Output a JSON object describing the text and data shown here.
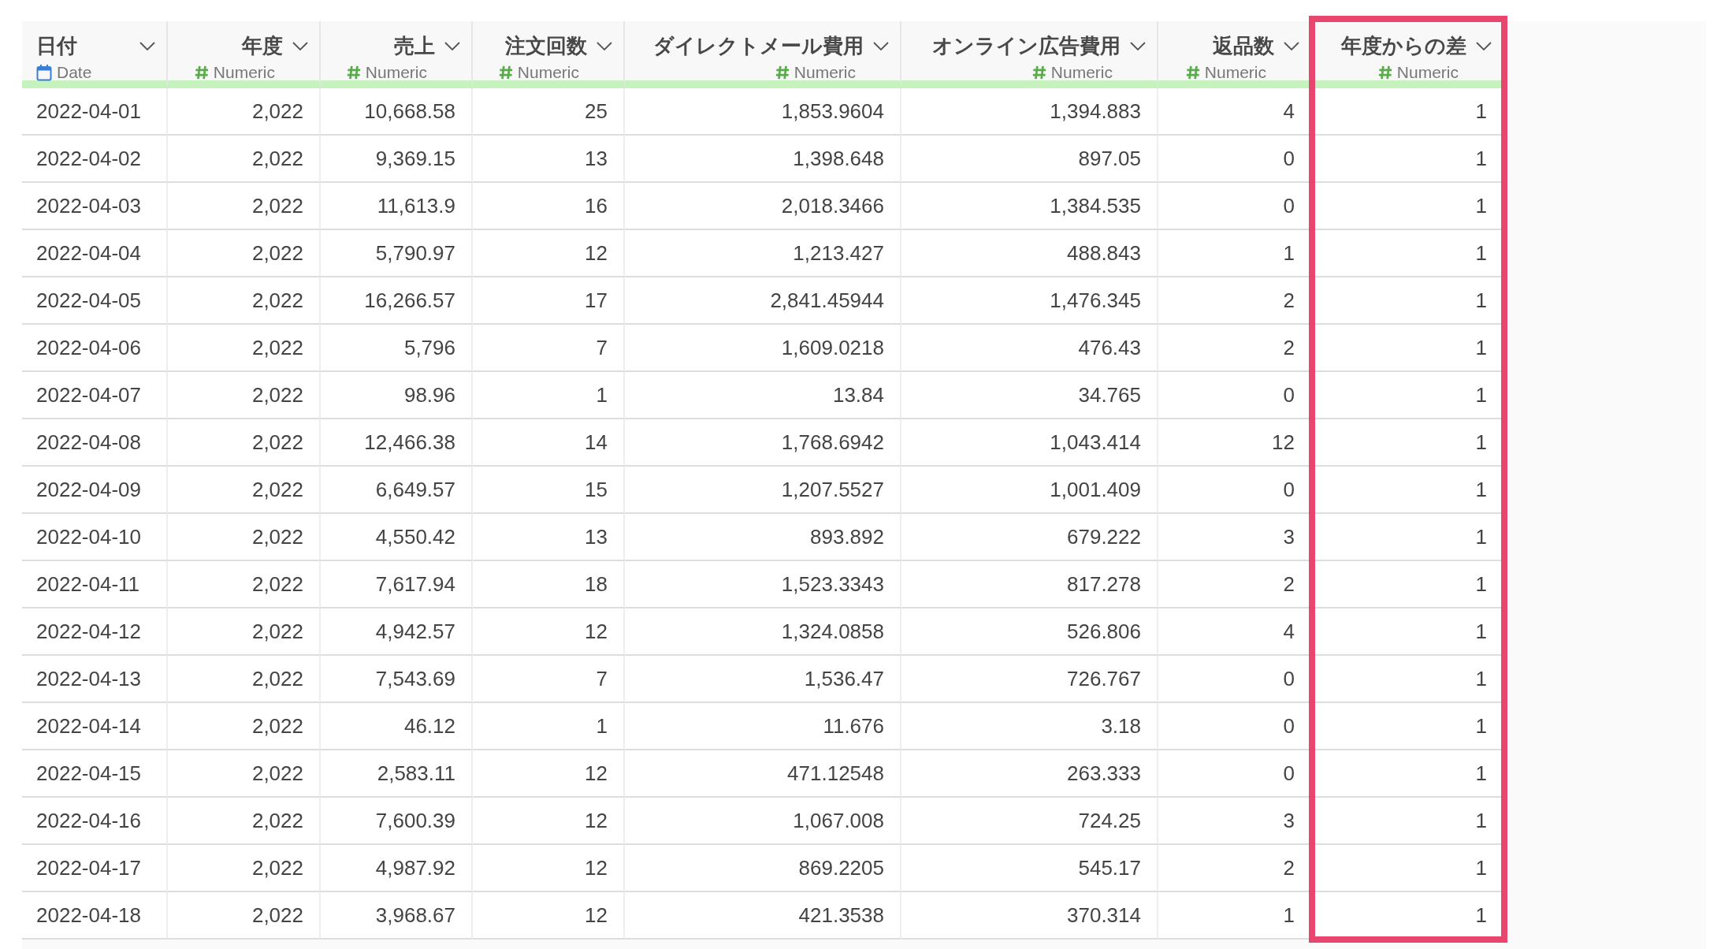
{
  "table": {
    "columns": [
      {
        "name": "日付",
        "type": "Date",
        "kind": "date",
        "highlighted": false
      },
      {
        "name": "年度",
        "type": "Numeric",
        "kind": "numeric",
        "highlighted": false
      },
      {
        "name": "売上",
        "type": "Numeric",
        "kind": "numeric",
        "highlighted": false
      },
      {
        "name": "注文回数",
        "type": "Numeric",
        "kind": "numeric",
        "highlighted": false
      },
      {
        "name": "ダイレクトメール費用",
        "type": "Numeric",
        "kind": "numeric",
        "highlighted": false
      },
      {
        "name": "オンライン広告費用",
        "type": "Numeric",
        "kind": "numeric",
        "highlighted": false
      },
      {
        "name": "返品数",
        "type": "Numeric",
        "kind": "numeric",
        "highlighted": false
      },
      {
        "name": "年度からの差",
        "type": "Numeric",
        "kind": "numeric",
        "highlighted": true
      }
    ],
    "rows": [
      [
        "2022-04-01",
        "2,022",
        "10,668.58",
        "25",
        "1,853.9604",
        "1,394.883",
        "4",
        "1"
      ],
      [
        "2022-04-02",
        "2,022",
        "9,369.15",
        "13",
        "1,398.648",
        "897.05",
        "0",
        "1"
      ],
      [
        "2022-04-03",
        "2,022",
        "11,613.9",
        "16",
        "2,018.3466",
        "1,384.535",
        "0",
        "1"
      ],
      [
        "2022-04-04",
        "2,022",
        "5,790.97",
        "12",
        "1,213.427",
        "488.843",
        "1",
        "1"
      ],
      [
        "2022-04-05",
        "2,022",
        "16,266.57",
        "17",
        "2,841.45944",
        "1,476.345",
        "2",
        "1"
      ],
      [
        "2022-04-06",
        "2,022",
        "5,796",
        "7",
        "1,609.0218",
        "476.43",
        "2",
        "1"
      ],
      [
        "2022-04-07",
        "2,022",
        "98.96",
        "1",
        "13.84",
        "34.765",
        "0",
        "1"
      ],
      [
        "2022-04-08",
        "2,022",
        "12,466.38",
        "14",
        "1,768.6942",
        "1,043.414",
        "12",
        "1"
      ],
      [
        "2022-04-09",
        "2,022",
        "6,649.57",
        "15",
        "1,207.5527",
        "1,001.409",
        "0",
        "1"
      ],
      [
        "2022-04-10",
        "2,022",
        "4,550.42",
        "13",
        "893.892",
        "679.222",
        "3",
        "1"
      ],
      [
        "2022-04-11",
        "2,022",
        "7,617.94",
        "18",
        "1,523.3343",
        "817.278",
        "2",
        "1"
      ],
      [
        "2022-04-12",
        "2,022",
        "4,942.57",
        "12",
        "1,324.0858",
        "526.806",
        "4",
        "1"
      ],
      [
        "2022-04-13",
        "2,022",
        "7,543.69",
        "7",
        "1,536.47",
        "726.767",
        "0",
        "1"
      ],
      [
        "2022-04-14",
        "2,022",
        "46.12",
        "1",
        "11.676",
        "3.18",
        "0",
        "1"
      ],
      [
        "2022-04-15",
        "2,022",
        "2,583.11",
        "12",
        "471.12548",
        "263.333",
        "0",
        "1"
      ],
      [
        "2022-04-16",
        "2,022",
        "7,600.39",
        "12",
        "1,067.008",
        "724.25",
        "3",
        "1"
      ],
      [
        "2022-04-17",
        "2,022",
        "4,987.92",
        "12",
        "869.2205",
        "545.17",
        "2",
        "1"
      ],
      [
        "2022-04-18",
        "2,022",
        "3,968.67",
        "12",
        "421.3538",
        "370.314",
        "1",
        "1"
      ]
    ]
  }
}
